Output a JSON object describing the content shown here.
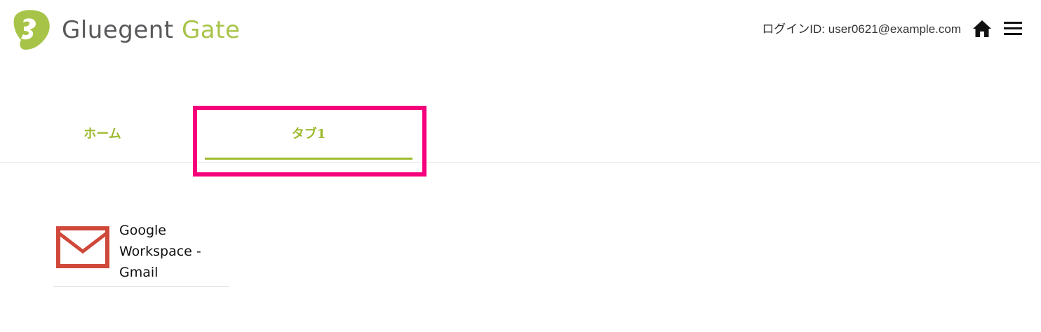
{
  "header": {
    "logo": {
      "word1": "Gluegent",
      "word2": "Gate"
    },
    "login_text": "ログインID: user0621@example.com",
    "icons": {
      "home": "home-icon",
      "menu": "hamburger-menu-icon"
    }
  },
  "tabs": [
    {
      "label": "ホーム",
      "active": false
    },
    {
      "label": "タブ1",
      "active": true
    }
  ],
  "apps": [
    {
      "label": "Google Workspace - Gmail",
      "icon": "mail-icon"
    }
  ],
  "colors": {
    "brand_gray": "#58595b",
    "brand_green": "#a7c449",
    "tab_green": "#9dba2e",
    "highlight": "#f5007a",
    "mail_red": "#d0483a"
  }
}
